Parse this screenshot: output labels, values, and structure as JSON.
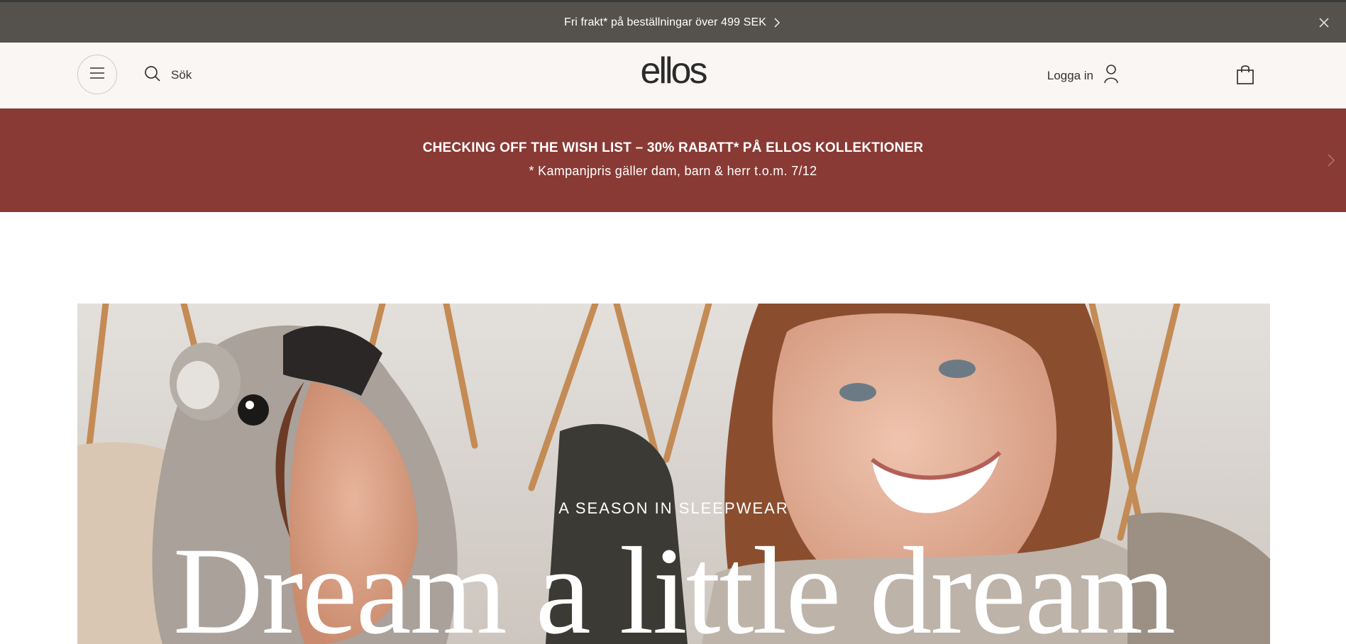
{
  "announcement": {
    "text": "Fri frakt* på beställningar över 499 SEK",
    "chevron_icon": "chevron-right-icon",
    "close_icon": "close-icon"
  },
  "header": {
    "logo": "ellos",
    "search_label": "Sök",
    "login_label": "Logga in",
    "icons": [
      "menu-icon",
      "search-icon",
      "user-icon",
      "shopping-bag-icon"
    ]
  },
  "promo": {
    "title": "CHECKING OFF THE WISH LIST – 30% RABATT* PÅ ELLOS KOLLEKTIONER",
    "subtitle": "* Kampanjpris gäller dam, barn & herr t.o.m. 7/12",
    "background": "#893a35"
  },
  "hero": {
    "kicker": "A SEASON IN SLEEPWEAR",
    "headline": "Dream a little dream"
  },
  "colors": {
    "announcement_bg": "#55524e",
    "header_bg": "#f9f6f3",
    "promo_bg": "#893a35"
  }
}
